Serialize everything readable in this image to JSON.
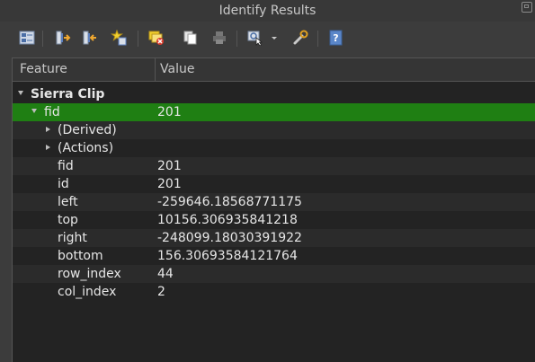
{
  "window": {
    "title": "Identify Results"
  },
  "toolbar": {
    "icons": [
      "expand-tree-icon",
      "expand-all-icon",
      "collapse-all-icon",
      "expand-new-icon",
      "clear-results-icon",
      "copy-icon",
      "print-icon",
      "identify-mode-icon",
      "dropdown-arrow-icon",
      "settings-icon",
      "help-icon"
    ]
  },
  "table": {
    "headers": {
      "feature": "Feature",
      "value": "Value"
    },
    "layer": {
      "label": "Sierra Clip"
    },
    "selected": {
      "label": "fid",
      "value": "201"
    },
    "derived": {
      "label": "(Derived)"
    },
    "actions": {
      "label": "(Actions)"
    },
    "attributes": [
      {
        "name": "fid",
        "value": "201"
      },
      {
        "name": "id",
        "value": "201"
      },
      {
        "name": "left",
        "value": "-259646.18568771175"
      },
      {
        "name": "top",
        "value": "10156.306935841218"
      },
      {
        "name": "right",
        "value": "-248099.18030391922"
      },
      {
        "name": "bottom",
        "value": "156.30693584121764"
      },
      {
        "name": "row_index",
        "value": "44"
      },
      {
        "name": "col_index",
        "value": "2"
      }
    ]
  },
  "colors": {
    "selection": "#1f7f13",
    "background": "#232323"
  }
}
